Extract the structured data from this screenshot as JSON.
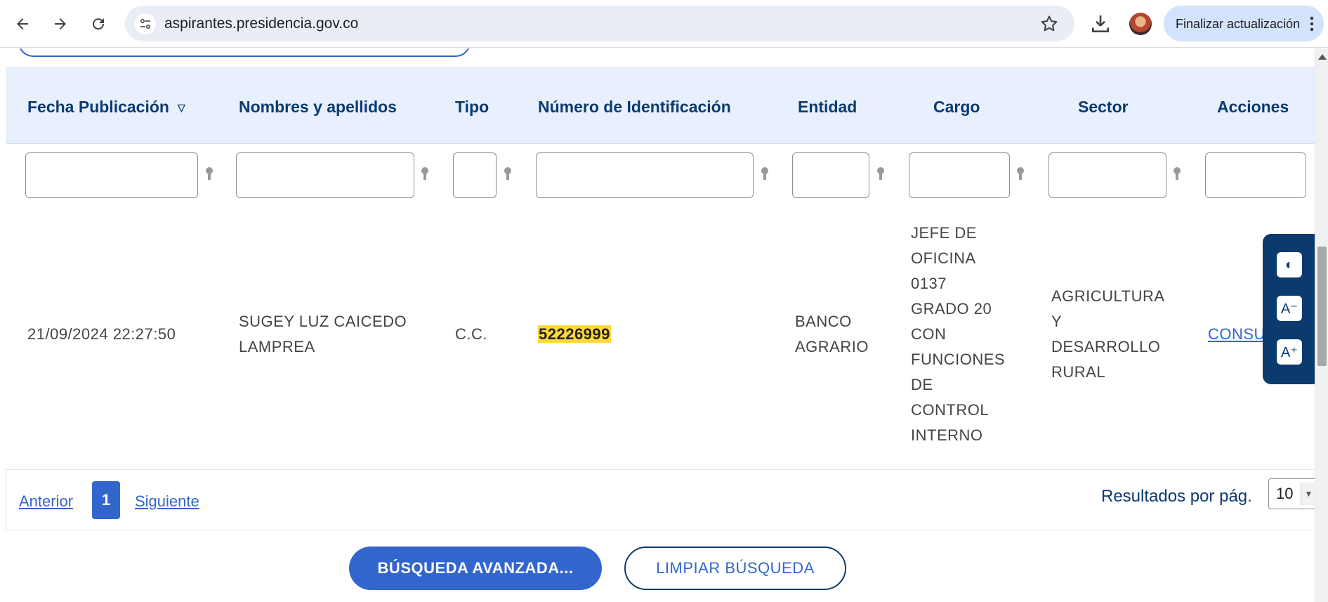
{
  "browser": {
    "url": "aspirantes.presidencia.gov.co",
    "update_label": "Finalizar actualización"
  },
  "table": {
    "headers": {
      "fecha": "Fecha Publicación",
      "nombres": "Nombres y apellidos",
      "tipo": "Tipo",
      "numero": "Número de Identificación",
      "entidad": "Entidad",
      "cargo": "Cargo",
      "sector": "Sector",
      "acciones": "Acciones"
    },
    "rows": [
      {
        "fecha": "21/09/2024 22:27:50",
        "nombres_1": "SUGEY LUZ CAICEDO",
        "nombres_2": "LAMPREA",
        "tipo": "C.C.",
        "numero": "52226999",
        "entidad_1": "BANCO",
        "entidad_2": "AGRARIO",
        "cargo_lines": [
          "JEFE DE",
          "OFICINA",
          "0137",
          "GRADO 20",
          "CON",
          "FUNCIONES",
          "DE",
          "CONTROL",
          "INTERNO"
        ],
        "sector_lines": [
          "AGRICULTURA",
          "Y",
          "DESARROLLO",
          "RURAL"
        ],
        "accion": "CONSU"
      }
    ]
  },
  "pager": {
    "prev": "Anterior",
    "current": "1",
    "next": "Siguiente",
    "results_label": "Resultados por pág.",
    "results_value": "10"
  },
  "actions": {
    "advanced": "BÚSQUEDA AVANZADA...",
    "clear": "LIMPIAR BÚSQUEDA"
  },
  "a11y": {
    "contrast": "◐",
    "decrease": "A⁻",
    "increase": "A⁺"
  },
  "colors": {
    "primary": "#3366cc",
    "navy": "#0b3a6e",
    "header_bg": "#e8f0fe",
    "highlight": "#ffd83a"
  }
}
